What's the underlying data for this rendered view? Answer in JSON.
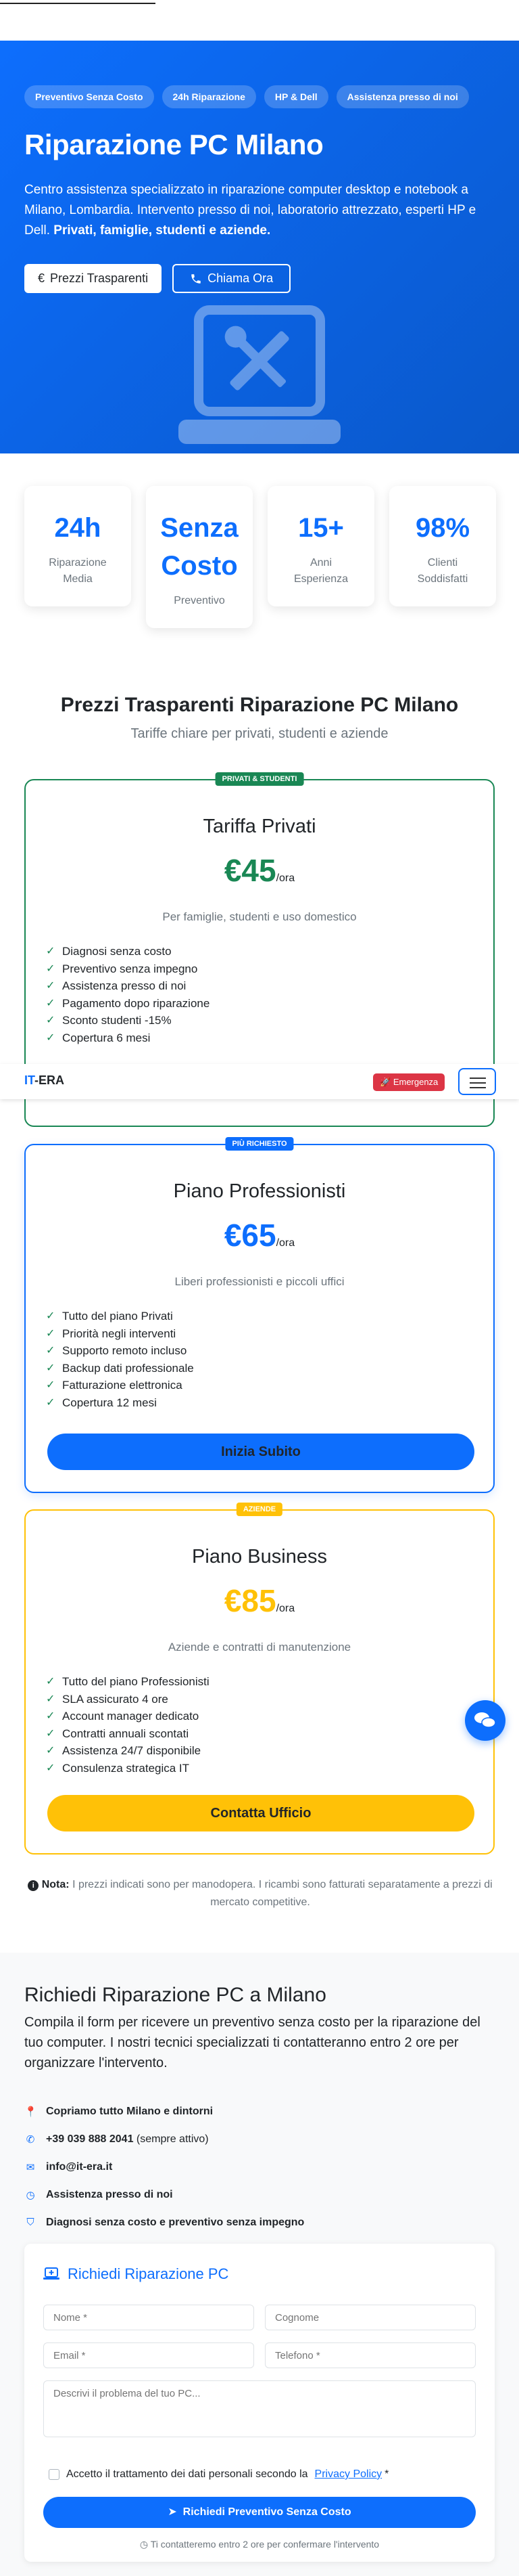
{
  "hero": {
    "badges": [
      "Preventivo Senza Costo",
      "24h Riparazione",
      "HP & Dell",
      "Assistenza presso di noi"
    ],
    "title": "Riparazione PC Milano",
    "lead_text": "Centro assistenza specializzato in riparazione computer desktop e notebook a Milano, Lombardia. Intervento presso di noi, laboratorio attrezzato, esperti HP e Dell.",
    "lead_bold": "Privati, famiglie, studenti e aziende.",
    "btn_prices": "Prezzi Trasparenti",
    "btn_call": "Chiama Ora",
    "btn_prices_icon": "euro-icon",
    "btn_call_icon": "phone-icon",
    "illustration_icon": "laptop-tools-icon"
  },
  "stats": [
    {
      "num": "24h",
      "label": "Riparazione Media"
    },
    {
      "num": "Senza Costo",
      "label": "Preventivo"
    },
    {
      "num": "15+",
      "label": "Anni Esperienza"
    },
    {
      "num": "98%",
      "label": "Clienti Soddisfatti"
    }
  ],
  "pricing": {
    "title": "Prezzi Trasparenti Riparazione PC Milano",
    "subtitle": "Tariffe chiare per privati, studenti e aziende",
    "plans": [
      {
        "tag": "PRIVATI & STUDENTI",
        "name": "Tariffa Privati",
        "price": "€45",
        "per": "/ora",
        "desc": "Per famiglie, studenti e uso domestico",
        "features": [
          "Diagnosi senza costo",
          "Preventivo senza impegno",
          "Assistenza presso di noi",
          "Pagamento dopo riparazione",
          "Sconto studenti -15%",
          "Copertura 6 mesi"
        ],
        "color": "#198754"
      },
      {
        "tag": "PIÙ RICHIESTO",
        "name": "Piano Professionisti",
        "price": "€65",
        "per": "/ora",
        "desc": "Liberi professionisti e piccoli uffici",
        "features": [
          "Tutto del piano Privati",
          "Priorità negli interventi",
          "Supporto remoto incluso",
          "Backup dati professionale",
          "Fatturazione elettronica",
          "Copertura 12 mesi"
        ],
        "cta": "Inizia Subito",
        "color": "#0d6efd"
      },
      {
        "tag": "AZIENDE",
        "name": "Piano Business",
        "price": "€85",
        "per": "/ora",
        "desc": "Aziende e contratti di manutenzione",
        "features": [
          "Tutto del piano Professionisti",
          "SLA assicurato 4 ore",
          "Account manager dedicato",
          "Contratti annuali scontati",
          "Assistenza 24/7 disponibile",
          "Consulenza strategica IT"
        ],
        "cta": "Contatta Ufficio",
        "color": "#ffc107"
      }
    ],
    "note_label": "Nota:",
    "note_text": "I prezzi indicati sono per manodopera. I ricambi sono fatturati separatamente a prezzi di mercato competitive."
  },
  "navbar": {
    "brand_it": "IT",
    "brand_rest": "-ERA",
    "emergency": "Emergenza",
    "emergency_icon": "rocket-icon",
    "menu_icon": "hamburger-icon"
  },
  "contact": {
    "title": "Richiedi Riparazione PC a Milano",
    "intro": "Compila il form per ricevere un preventivo senza costo per la riparazione del tuo computer. I nostri tecnici specializzati ti contatteranno entro 2 ore per organizzare l'intervento.",
    "info": [
      {
        "icon": "map-pin-icon",
        "text": "Copriamo tutto Milano e dintorni",
        "extra": ""
      },
      {
        "icon": "phone-icon",
        "text": "+39 039 888 2041",
        "extra": " (sempre attivo)"
      },
      {
        "icon": "envelope-icon",
        "text": "info@it-era.it",
        "extra": ""
      },
      {
        "icon": "clock-icon",
        "text": "Assistenza presso di noi",
        "extra": ""
      },
      {
        "icon": "shield-icon",
        "text": "Diagnosi senza costo e preventivo senza impegno",
        "extra": ""
      }
    ],
    "form": {
      "title": "Richiedi Riparazione PC",
      "nome": "Nome *",
      "cognome": "Cognome",
      "email": "Email *",
      "telefono": "Telefono *",
      "problem": "Descrivi il problema del tuo PC...",
      "privacy_text": "Accetto il trattamento dei dati personali secondo la",
      "privacy_link": "Privacy Policy",
      "privacy_star": "*",
      "submit": "Richiedi Preventivo Senza Costo",
      "reply": "Ti contatteremo entro 2 ore per confermare l'intervento"
    }
  },
  "chat_icon": "chat-bubbles-icon"
}
